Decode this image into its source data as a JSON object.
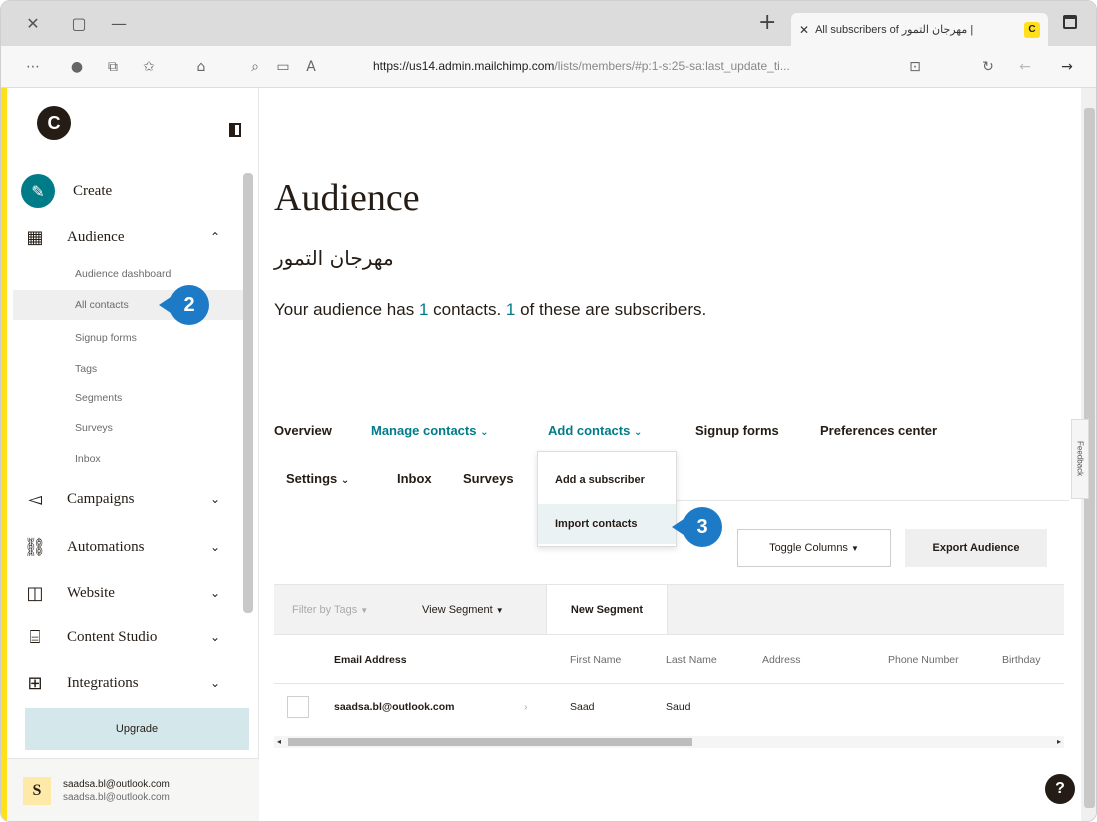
{
  "browser": {
    "tab_title": "All subscribers of مهرجان التمور |",
    "tab_favicon": "mailchimp-favicon",
    "url_host": "https://us14.admin.mailchimp.com",
    "url_path": "/lists/members/#p:1-s:25-sa:last_update_ti...",
    "icons": [
      "close-icon",
      "minimize-icon",
      "new-tab-icon",
      "maximize-icon",
      "more-icon",
      "profile-icon",
      "collections-icon",
      "favorites-icon",
      "home-icon",
      "search-icon",
      "reader-icon",
      "read-aloud-icon",
      "lock-icon",
      "refresh-icon",
      "back-icon",
      "forward-icon"
    ]
  },
  "sidebar": {
    "logo": "mailchimp-logo",
    "create": "Create",
    "audience": "Audience",
    "audience_sub": [
      "Audience dashboard",
      "All contacts",
      "Signup forms",
      "Tags",
      "Segments",
      "Surveys",
      "Inbox"
    ],
    "campaigns": "Campaigns",
    "automations": "Automations",
    "website": "Website",
    "content_studio": "Content Studio",
    "integrations": "Integrations",
    "upgrade": "Upgrade",
    "account_initial": "S",
    "account_name": "saadsa.bl@outlook.com",
    "account_email": "saadsa.bl@outlook.com"
  },
  "callouts": {
    "step2": "2",
    "step3": "3"
  },
  "main": {
    "title": "Audience",
    "audience_name": "مهرجان التمور",
    "summary_pre": "Your audience has ",
    "summary_contacts": "1",
    "summary_mid": " contacts. ",
    "summary_subscribers": "1",
    "summary_post": " of these are subscribers.",
    "tabs_row1": [
      "Overview",
      "Manage contacts",
      "Add contacts",
      "Signup forms",
      "Preferences center"
    ],
    "tabs_row2": [
      "Settings",
      "Inbox",
      "Surveys"
    ],
    "dropdown": [
      "Add a subscriber",
      "Import contacts"
    ],
    "toggle_columns": "Toggle Columns",
    "export_audience": "Export Audience",
    "filter_by_tags": "Filter by Tags",
    "view_segment": "View Segment",
    "new_segment": "New Segment",
    "columns": [
      "Email Address",
      "First Name",
      "Last Name",
      "Address",
      "Phone Number",
      "Birthday"
    ],
    "rows": [
      {
        "email": "saadsa.bl@outlook.com",
        "first_name": "Saad",
        "last_name": "Saud"
      }
    ],
    "feedback": "Feedback",
    "help": "?"
  },
  "colors": {
    "brand_yellow": "#ffe01b",
    "teal": "#007c89",
    "callout_blue": "#1d7ac7",
    "ink": "#241c15"
  }
}
